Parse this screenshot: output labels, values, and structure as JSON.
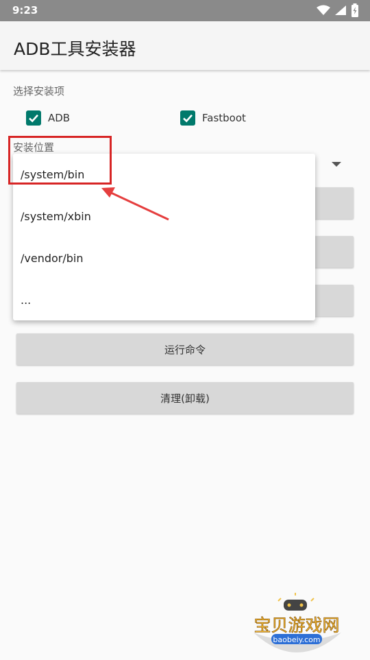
{
  "status_bar": {
    "time": "9:23",
    "icons": [
      "wifi-icon",
      "signal-icon",
      "battery-icon"
    ]
  },
  "app_bar": {
    "title": "ADB工具安装器"
  },
  "install_items": {
    "label": "选择安装项",
    "options": [
      {
        "label": "ADB",
        "checked": true
      },
      {
        "label": "Fastboot",
        "checked": true
      }
    ]
  },
  "install_location": {
    "label": "安装位置",
    "dropdown_options": [
      "/system/bin",
      "/system/xbin",
      "/vendor/bin",
      "..."
    ]
  },
  "buttons": {
    "run_command": "运行命令",
    "clean_uninstall": "清理(卸载)"
  },
  "watermark": {
    "name": "宝贝游戏网",
    "url": "baobeiy.com"
  },
  "colors": {
    "accent": "#00796b",
    "highlight": "#d72525",
    "button_bg": "#d8d8d8"
  }
}
